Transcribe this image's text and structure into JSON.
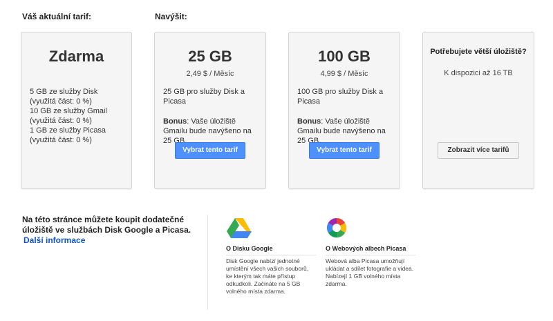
{
  "current_label": "Váš aktuální tarif:",
  "upgrade_label": "Navýšit:",
  "current_plan": {
    "title": "Zdarma",
    "lines": [
      "5 GB ze služby Disk (využitá část: 0 %)",
      "10 GB ze služby Gmail (využitá část: 0 %)",
      "1 GB ze služby Picasa (využitá část: 0 %)"
    ]
  },
  "plans": [
    {
      "title": "25 GB",
      "price": "2,49 $ / Měsíc",
      "description": "25 GB pro služby Disk a Picasa",
      "bonus_label": "Bonus",
      "bonus_text": ": Vaše úložiště Gmailu bude navýšeno na 25 GB.",
      "button": "Vybrat tento tarif"
    },
    {
      "title": "100 GB",
      "price": "4,99 $ / Měsíc",
      "description": "100 GB pro služby Disk a Picasa",
      "bonus_label": "Bonus",
      "bonus_text": ": Vaše úložiště Gmailu bude navýšeno na 25 GB.",
      "button": "Vybrat tento tarif"
    }
  ],
  "more": {
    "title": "Potřebujete větší úložiště?",
    "available": "K dispozici až 16 TB",
    "button": "Zobrazit více tarifů"
  },
  "promo": {
    "text": "Na této stránce můžete koupit dodatečné úložiště ve službách Disk Google a Picasa.",
    "link": "Další informace"
  },
  "apps": [
    {
      "icon": "google-drive-icon",
      "title": "O Disku Google",
      "description": "Disk Google nabízí jednotné umístění všech vašich souborů, ke kterým tak máte přístup odkudkoli. Začínáte na 5 GB volného místa zdarma."
    },
    {
      "icon": "picasa-icon",
      "title": "O Webových albech Picasa",
      "description": "Webová alba Picasa umožňují ukládat a sdílet fotografie a videa. Nabízejí 1 GB volného místa zdarma."
    }
  ],
  "colors": {
    "button_blue": "#4d90fe",
    "link": "#1155cc",
    "card_bg": "#f5f5f5"
  }
}
